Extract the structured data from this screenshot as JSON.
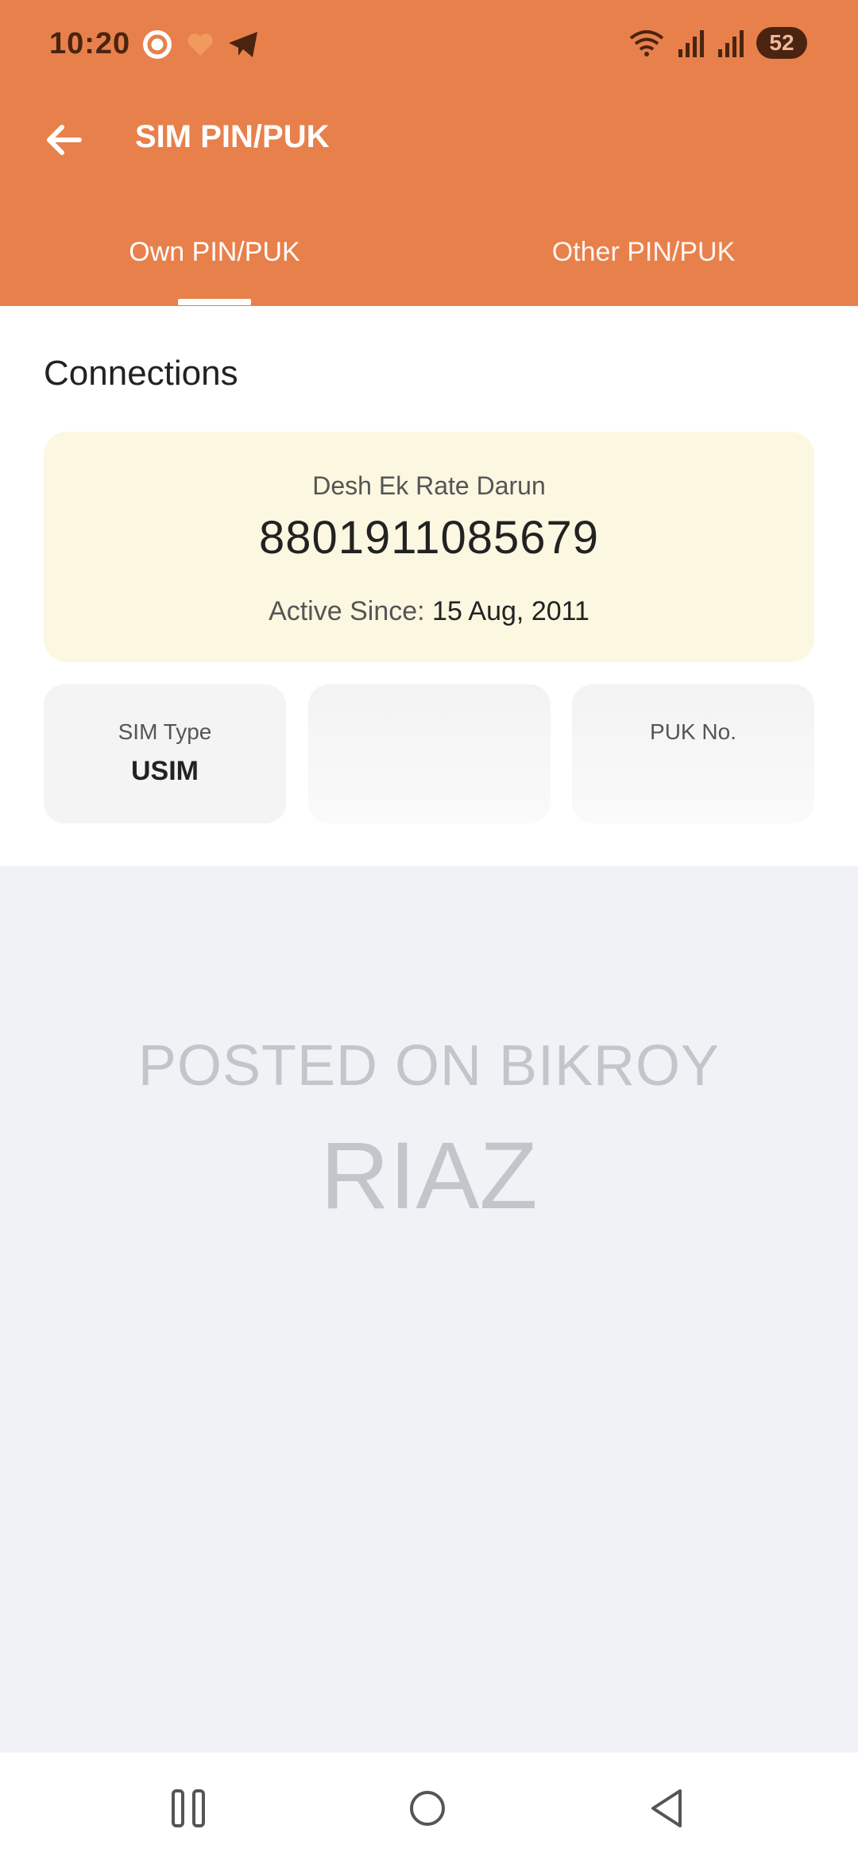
{
  "status_bar": {
    "time": "10:20",
    "battery": "52",
    "left_icons": [
      "bikroy-app-icon",
      "heart-icon",
      "telegram-icon"
    ],
    "right_icons": [
      "wifi-icon",
      "signal-icon",
      "signal-icon"
    ]
  },
  "toolbar": {
    "title": "SIM PIN/PUK",
    "back_icon": "arrow-left-icon"
  },
  "tabs": [
    {
      "label": "Own PIN/PUK",
      "selected": true
    },
    {
      "label": "Other PIN/PUK",
      "selected": false
    }
  ],
  "connections": {
    "title": "Connections",
    "plan_name": "Desh Ek Rate Darun",
    "number": "8801911085679",
    "active_since_label": "Active Since:",
    "active_since_date": "15 Aug, 2011"
  },
  "info_cards": [
    {
      "label": "SIM Type",
      "value": "USIM"
    },
    {
      "label": "",
      "value": ""
    },
    {
      "label": "PUK No.",
      "value": ""
    }
  ],
  "watermark": {
    "line1": "POSTED ON BIKROY",
    "line2": "RIAZ"
  },
  "colors": {
    "accent": "#e8804b",
    "card_background": "#fbf7e1",
    "page_background": "#f1f2f6"
  },
  "nav_bar": [
    "recents-icon",
    "home-icon",
    "back-icon"
  ]
}
